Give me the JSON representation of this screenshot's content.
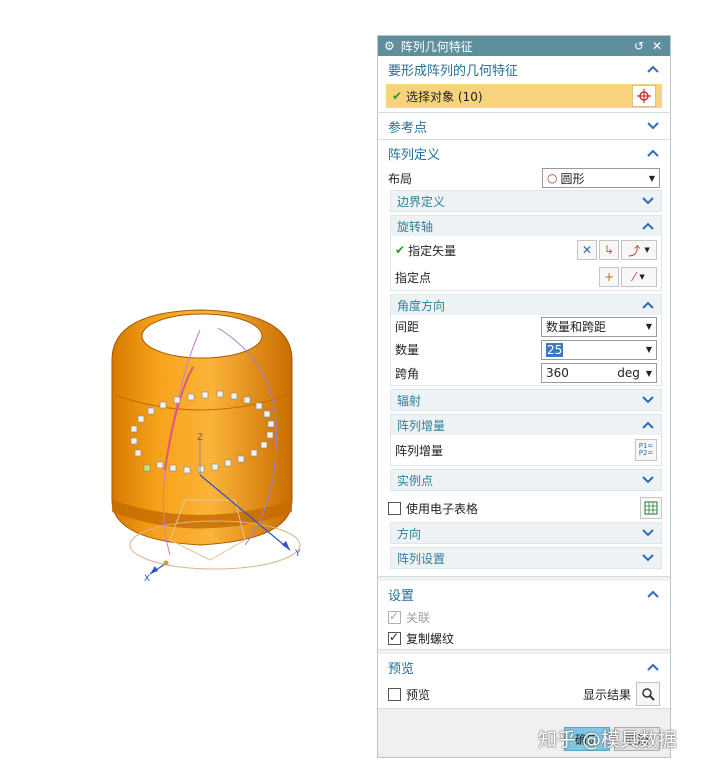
{
  "dialog": {
    "title": "阵列几何特征",
    "reset_icon": "reset-icon",
    "close_icon": "close-icon"
  },
  "geometry": {
    "header": "要形成阵列的几何特征",
    "select": "选择对象 (10)"
  },
  "refpoint": {
    "header": "参考点"
  },
  "pattern": {
    "header": "阵列定义",
    "layout_label": "布局",
    "layout_value": "圆形",
    "boundary": "边界定义",
    "axis": {
      "header": "旋转轴",
      "vector": "指定矢量",
      "point": "指定点"
    },
    "angle": {
      "header": "角度方向",
      "spacing_label": "间距",
      "spacing_value": "数量和跨距",
      "count_label": "数量",
      "count_value": "25",
      "span_label": "跨角",
      "span_value": "360",
      "span_unit": "deg"
    },
    "radiate": "辐射",
    "increment": {
      "header": "阵列增量",
      "label": "阵列增量"
    },
    "instance": {
      "header": "实例点",
      "use_sheet": "使用电子表格"
    },
    "orientation": "方向",
    "settings": "阵列设置"
  },
  "settings": {
    "header": "设置",
    "associative": "关联",
    "copy_threads": "复制螺纹"
  },
  "preview": {
    "header": "预览",
    "label": "预览",
    "show_result": "显示结果"
  },
  "buttons": {
    "ok": "确定",
    "cancel": "取消"
  },
  "axes": {
    "x": "X",
    "y": "Y",
    "z": "Z"
  },
  "watermark": "知乎 @模具数据",
  "colors": {
    "title_bg": "#5f8f9c",
    "body": "#f39c12",
    "accent": "#246f98",
    "ok_bg": "#7ec7e4"
  }
}
